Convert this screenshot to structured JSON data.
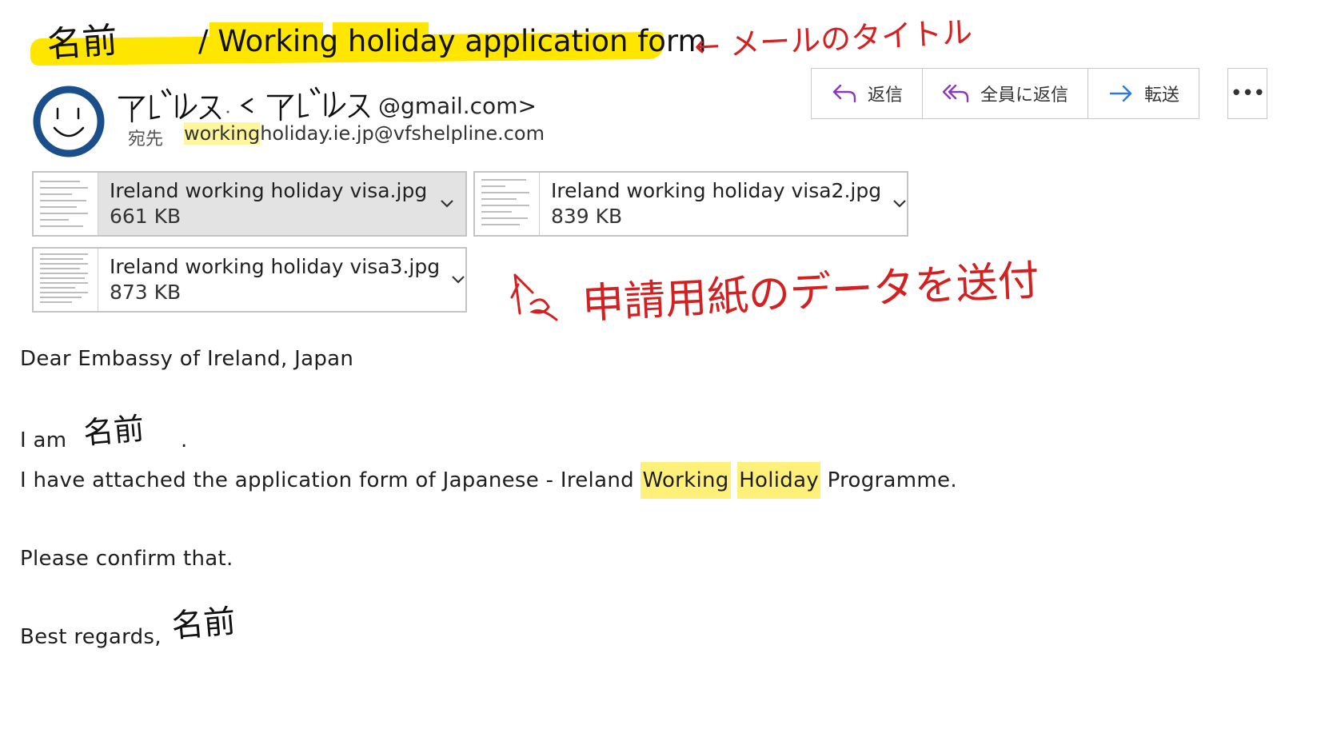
{
  "email": {
    "subject": "/ Working holiday application form",
    "handwritten_name": "名前",
    "sender_email_suffix": "@gmail.com>",
    "to_label": "宛先",
    "to_address_highlight": "working",
    "to_address_rest": "holiday.ie.jp@vfshelpline.com"
  },
  "actions": [
    {
      "label": "返信",
      "icon": "reply-icon"
    },
    {
      "label": "全員に返信",
      "icon": "reply-all-icon"
    },
    {
      "label": "転送",
      "icon": "forward-icon"
    }
  ],
  "more_label": "•••",
  "attachments": [
    {
      "name": "Ireland working holiday visa.jpg",
      "size": "661 KB",
      "selected": true
    },
    {
      "name": "Ireland working holiday visa2.jpg",
      "size": "839 KB",
      "selected": false
    },
    {
      "name": "Ireland working holiday visa3.jpg",
      "size": "873 KB",
      "selected": false
    }
  ],
  "body": {
    "greeting": "Dear Embassy of Ireland, Japan",
    "i_am": "I am",
    "i_am_end": ".",
    "attached_pre": "I have attached the application form of Japanese -  Ireland ",
    "attached_hl1": "Working",
    "attached_hl2": "Holiday",
    "attached_post": " Programme.",
    "confirm": "Please confirm that.",
    "regards": "Best regards,"
  },
  "annotations": {
    "title_note": "← メールのタイトル",
    "attachment_note": "申請用紙のデータを送付"
  },
  "colors": {
    "highlight": "#ffe600",
    "annotation_red": "#d42020",
    "avatar_blue": "#1a4f8c",
    "accent_blue": "#2b7bd6"
  }
}
